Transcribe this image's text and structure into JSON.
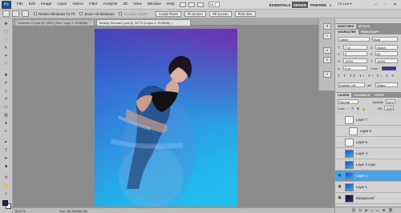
{
  "app": {
    "logo": "Ps",
    "menu": [
      "File",
      "Edit",
      "Image",
      "Layer",
      "Select",
      "Filter",
      "Analysis",
      "3D",
      "View",
      "Window",
      "Help"
    ],
    "zoom_select": "16.7",
    "workspaces": [
      "ESSENTIALS",
      "DESIGN",
      "PAINTING",
      "»"
    ],
    "cs_live": "CS Live ▾",
    "window_controls": [
      "–",
      "▫",
      "✕"
    ]
  },
  "options_bar": {
    "resize_windows_label": "Resize Windows To Fit",
    "zoom_all_label": "Zoom All Windows",
    "scrubby_zoom_label": "Scrubby Zoom",
    "buttons": [
      "Actual Pixels",
      "Fit Screen",
      "Fill Screen",
      "Print Size"
    ]
  },
  "documents": {
    "tabs": [
      "Summer 22.psd @ 100% (Text / copy 3, RGB/8#)",
      "Beauty Woman2.psd @ 16.7% (Layer 3, RGB/8#) ×"
    ]
  },
  "status_bar": {
    "zoom": "16.67%",
    "doc_size": "Doc: 36.2M/866.2M"
  },
  "character_panel": {
    "tabs": [
      "CHARACTER",
      "PARAGRAPH"
    ],
    "font_family": "Calibri",
    "font_style": "Bold",
    "font_size": "7 pt",
    "leading": "(Auto)",
    "kerning": "0",
    "tracking": "60",
    "vertical_scale": "100%",
    "horizontal_scale": "100%",
    "baseline_shift": "0 pt",
    "color_label": "Color:",
    "language": "English: UK",
    "anti_alias": "Sharp"
  },
  "top_panel_tabs": [
    "SWATCHES",
    "STYLES"
  ],
  "layers_panel": {
    "tabs": [
      "LAYERS",
      "CHANNELS",
      "PATHS"
    ],
    "blend_mode": "Normal",
    "opacity_label": "Opacity:",
    "opacity": "94%",
    "lock_label": "Lock:",
    "fill_label": "Fill:",
    "fill": "100%",
    "layers": [
      {
        "name": "Layer 7",
        "visible": false,
        "thumb": "white",
        "indent": false,
        "selected": false
      },
      {
        "name": "Layer 6",
        "visible": false,
        "thumb": "white",
        "indent": true,
        "selected": false
      },
      {
        "name": "Layer 5",
        "visible": false,
        "thumb": "white",
        "indent": false,
        "selected": false
      },
      {
        "name": "Layer 4",
        "visible": false,
        "thumb": "blue",
        "indent": false,
        "selected": false
      },
      {
        "name": "Layer 2 copy",
        "visible": false,
        "thumb": "blue",
        "indent": false,
        "selected": false
      },
      {
        "name": "Layer 3",
        "visible": true,
        "thumb": "blue",
        "indent": false,
        "selected": true
      },
      {
        "name": "Layer 1",
        "visible": true,
        "thumb": "blue",
        "indent": false,
        "selected": false
      },
      {
        "name": "Background",
        "visible": true,
        "thumb": "dark",
        "indent": false,
        "selected": false
      }
    ],
    "footer_icons": [
      "link-icon",
      "fx-icon",
      "mask-icon",
      "adjustment-icon",
      "folder-icon",
      "new-layer-icon",
      "trash-icon"
    ]
  },
  "colors": {
    "foreground": "#2f1a78",
    "background": "#ffffff",
    "selection": "#4aa3e6",
    "text_color": "#4a2a8c"
  }
}
